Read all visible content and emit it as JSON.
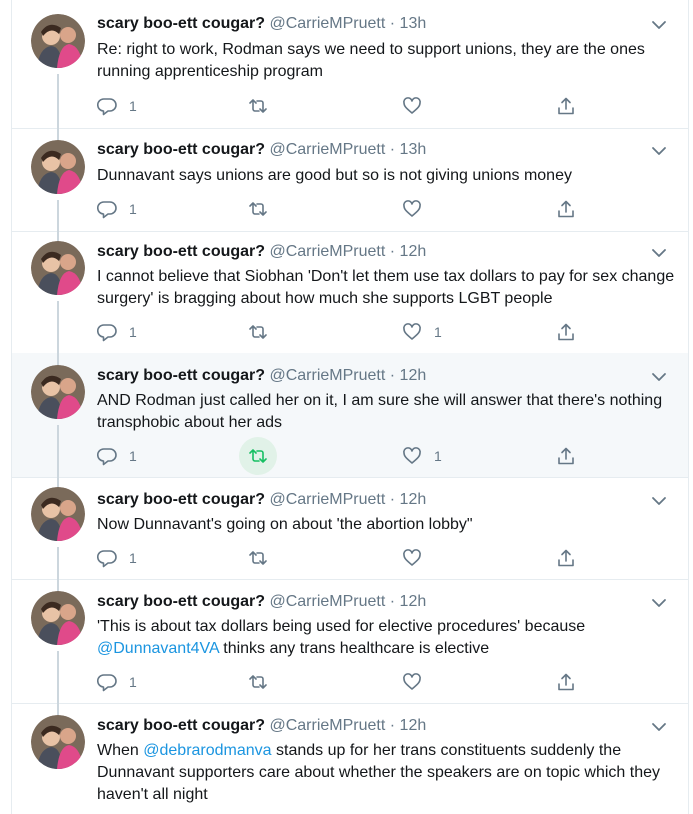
{
  "author": {
    "name": "scary boo-ett cougar?",
    "handle": "@CarrieMPruett",
    "separator": "·"
  },
  "colors": {
    "border": "#e6ecf0",
    "secondary_text": "#657786",
    "link": "#1b95e0",
    "retweet_active": "#17bf63"
  },
  "tweets": [
    {
      "time": "13h",
      "text_parts": [
        "Re: right to work, Rodman says we need to support unions, they are the ones running apprenticeship program"
      ],
      "reply_count": "1",
      "retweet_count": "",
      "like_count": ""
    },
    {
      "time": "13h",
      "text_parts": [
        "Dunnavant says unions are good but so is not giving unions money"
      ],
      "reply_count": "1",
      "retweet_count": "",
      "like_count": ""
    },
    {
      "time": "12h",
      "text_parts": [
        "I cannot believe that Siobhan 'Don't let them use tax dollars to pay for sex change surgery' is bragging about how much she supports LGBT people"
      ],
      "reply_count": "1",
      "retweet_count": "",
      "like_count": "1"
    },
    {
      "time": "12h",
      "text_parts": [
        "AND Rodman just called her on it, I am sure she will answer that there's nothing transphobic about her ads"
      ],
      "reply_count": "1",
      "retweet_count": "",
      "like_count": "1"
    },
    {
      "time": "12h",
      "text_parts": [
        "Now Dunnavant's going on about 'the abortion lobby\""
      ],
      "reply_count": "1",
      "retweet_count": "",
      "like_count": ""
    },
    {
      "time": "12h",
      "text_parts": [
        "'This is about tax dollars being used for elective procedures'  because ",
        "@Dunnavant4VA",
        " thinks any trans healthcare is elective"
      ],
      "reply_count": "1",
      "retweet_count": "",
      "like_count": ""
    },
    {
      "time": "12h",
      "text_parts": [
        "When ",
        "@debrarodmanva",
        " stands up for her trans constituents suddenly the Dunnavant supporters care about whether the speakers are on topic which they haven't all night"
      ],
      "reply_count": "",
      "retweet_count": "",
      "like_count": ""
    }
  ]
}
